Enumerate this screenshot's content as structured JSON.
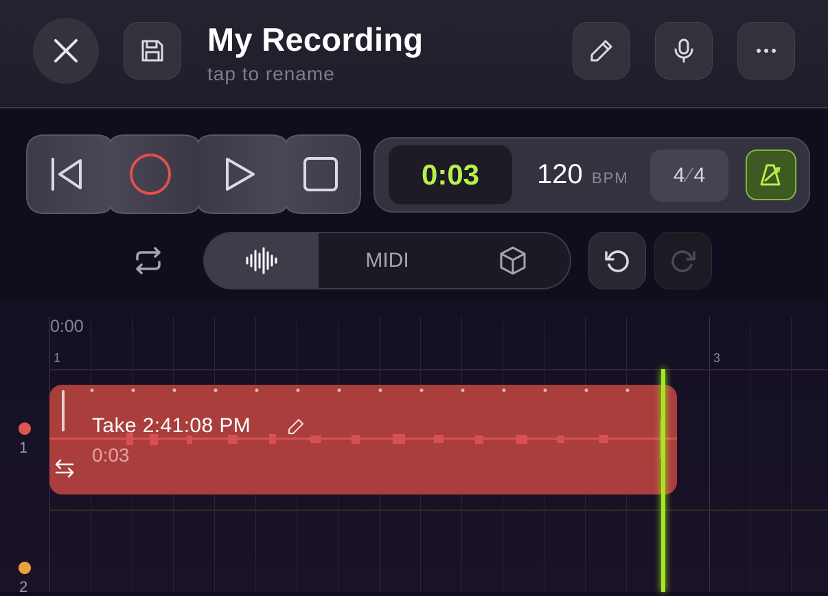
{
  "header": {
    "title": "My Recording",
    "subtitle": "tap to rename",
    "close_icon": "close-icon",
    "save_icon": "save-icon",
    "edit_icon": "pencil-icon",
    "mic_icon": "microphone-icon",
    "more_icon": "more-icon"
  },
  "transport": {
    "buttons": [
      "skip-back",
      "record",
      "play",
      "stop"
    ],
    "record_color": "#e2504b"
  },
  "time": {
    "position": "0:03",
    "bpm": "120",
    "bpm_label": "BPM",
    "ts_top": "4",
    "ts_bottom": "4",
    "accent": "#b7f04b"
  },
  "modes": {
    "loop_icon": "loop-icon",
    "items": [
      "audio",
      "MIDI",
      "3d"
    ],
    "midi_label": "MIDI",
    "active": "audio",
    "undo_icon": "undo-icon",
    "redo_icon": "redo-icon"
  },
  "timeline": {
    "ruler_time": "0:00",
    "bar_1": "1",
    "bar_3": "3",
    "tracks": [
      {
        "number": "1",
        "color": "#e05452"
      },
      {
        "number": "2",
        "color": "#e9a23b"
      }
    ],
    "clip": {
      "title": "Take 2:41:08 PM",
      "duration": "0:03",
      "color": "#b0403f"
    },
    "playhead_color": "#a4e81f"
  }
}
